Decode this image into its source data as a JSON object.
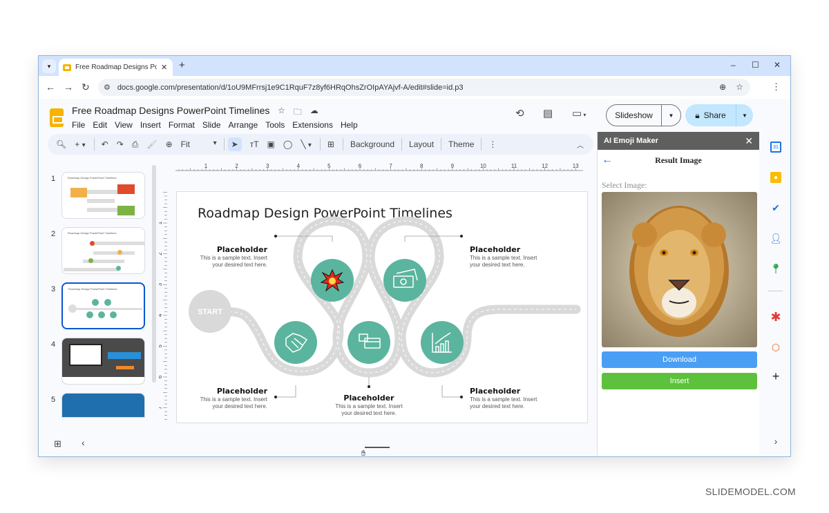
{
  "browser": {
    "tab_title": "Free Roadmap Designs PowerPoint Timelines",
    "tab_title_visible": "Free Roadmap Designs PowerP",
    "url": "docs.google.com/presentation/d/1oU9MFrrsj1e9C1RquF7z8yf6HRqOhsZrOIpAYAjvf-A/edit#slide=id.p3",
    "icons": {
      "tab_dropdown": "▾",
      "close": "✕",
      "new_tab": "+",
      "minimize": "–",
      "maximize": "☐",
      "close_window": "✕",
      "back": "←",
      "forward": "→",
      "reload": "↻",
      "site_info": "⚙",
      "zoom": "⊕",
      "star": "☆",
      "menu": "⋮"
    }
  },
  "app": {
    "doc_title": "Free Roadmap Designs PowerPoint Timelines",
    "menus": [
      "File",
      "Edit",
      "View",
      "Insert",
      "Format",
      "Slide",
      "Arrange",
      "Tools",
      "Extensions",
      "Help"
    ],
    "slideshow_label": "Slideshow",
    "share_label": "Share",
    "toolbar": {
      "zoom_value": "Fit",
      "background_label": "Background",
      "layout_label": "Layout",
      "theme_label": "Theme"
    }
  },
  "filmstrip": {
    "slides": [
      {
        "number": "1",
        "title": "Roadmap Design PowerPoint Timelines"
      },
      {
        "number": "2",
        "title": "Roadmap Design PowerPoint Timelines"
      },
      {
        "number": "3",
        "title": "Roadmap Design PowerPoint Timelines",
        "active": true
      },
      {
        "number": "4",
        "title": ""
      },
      {
        "number": "5",
        "title": ""
      }
    ]
  },
  "rulers": {
    "horizontal": [
      "1",
      "2",
      "3",
      "4",
      "5",
      "6",
      "7",
      "8",
      "9",
      "10",
      "11",
      "12",
      "13"
    ],
    "vertical": [
      "1",
      "2",
      "3",
      "4",
      "5",
      "6",
      "7"
    ]
  },
  "slide": {
    "title": "Roadmap Design PowerPoint Timelines",
    "start_label": "START",
    "accent_color": "#5bb59e",
    "road_color": "#d9d9d9",
    "placeholders": [
      {
        "heading": "Placeholder",
        "line1": "This is a sample text. Insert",
        "line2": "your desired text here."
      },
      {
        "heading": "Placeholder",
        "line1": "This is a sample text. Insert",
        "line2": "your desired text here."
      },
      {
        "heading": "Placeholder",
        "line1": "This is a sample text. Insert",
        "line2": "your desired text here."
      },
      {
        "heading": "Placeholder",
        "line1": "This is a sample text. Insert",
        "line2": "your desired text here."
      },
      {
        "heading": "Placeholder",
        "line1": "This is a sample text. Insert",
        "line2": "your desired text here."
      }
    ],
    "milestone_icons": [
      "explosion-icon",
      "money-icon",
      "handshake-icon",
      "card-payment-icon",
      "growth-chart-icon"
    ]
  },
  "addon_panel": {
    "title": "AI Emoji Maker",
    "result_title": "Result Image",
    "select_label": "Select Image:",
    "download_label": "Download",
    "insert_label": "Insert",
    "download_color": "#4a9ff5",
    "insert_color": "#5ec13e"
  },
  "side_rail": [
    "calendar-icon",
    "keep-icon",
    "tasks-icon",
    "contacts-icon",
    "maps-icon",
    "asterisk-addon-icon",
    "office-addon-icon",
    "add-icon"
  ],
  "watermark": "SLIDEMODEL.COM"
}
